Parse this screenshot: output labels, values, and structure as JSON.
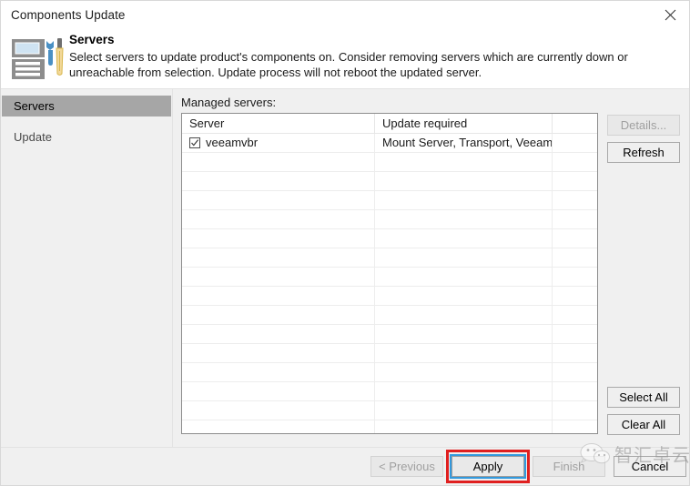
{
  "window": {
    "title": "Components Update",
    "close_icon": "close-icon"
  },
  "header": {
    "icon": "server-tools-icon",
    "title": "Servers",
    "description": "Select servers to update product's components on. Consider removing servers which are currently down or unreachable from selection. Update process will not reboot the updated server."
  },
  "sidebar": {
    "items": [
      {
        "label": "Servers",
        "active": true
      },
      {
        "label": "Update",
        "active": false
      }
    ]
  },
  "main": {
    "list_label": "Managed servers:",
    "table": {
      "columns": [
        "Server",
        "Update required",
        ""
      ],
      "rows": [
        {
          "checked": true,
          "server": "veeamvbr",
          "update_required": "Mount Server, Transport, Veeam Ag...",
          "extra": ""
        }
      ],
      "empty_row_count": 15
    },
    "side_buttons": [
      {
        "label": "Details...",
        "name": "details-button",
        "disabled": true
      },
      {
        "label": "Refresh",
        "name": "refresh-button",
        "disabled": false
      },
      {
        "label": "Select All",
        "name": "select-all-button",
        "disabled": false
      },
      {
        "label": "Clear All",
        "name": "clear-all-button",
        "disabled": false
      }
    ]
  },
  "footer": {
    "buttons": [
      {
        "label": "< Previous",
        "name": "previous-button",
        "disabled": true
      },
      {
        "label": "Apply",
        "name": "apply-button",
        "disabled": false,
        "focused": true,
        "highlighted": true
      },
      {
        "label": "Finish",
        "name": "finish-button",
        "disabled": true
      },
      {
        "label": "Cancel",
        "name": "cancel-button",
        "disabled": false
      }
    ]
  },
  "watermark": {
    "text": "智汇卓云",
    "logo": "wechat-logo-icon"
  },
  "colors": {
    "accent_focus": "#3399dd",
    "annotation": "#e02020",
    "sidebar_bg": "#f0f0f0",
    "sidebar_active": "#a6a6a6",
    "icon_blue": "#4a90c4",
    "icon_gray": "#8d8d8d",
    "icon_yellow": "#e8c46a"
  }
}
